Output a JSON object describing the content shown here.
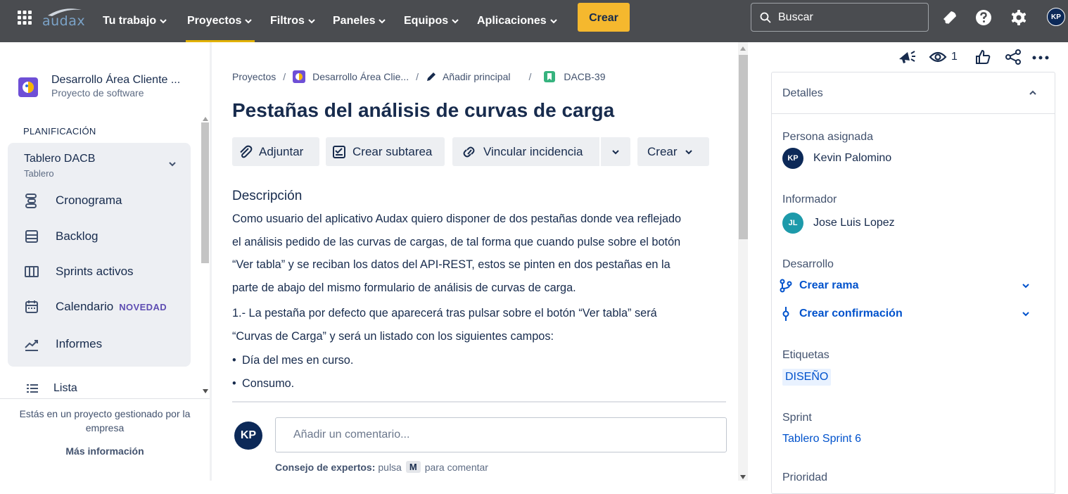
{
  "nav": {
    "logo_text": "audax",
    "items": [
      {
        "label": "Tu trabajo"
      },
      {
        "label": "Proyectos"
      },
      {
        "label": "Filtros"
      },
      {
        "label": "Paneles"
      },
      {
        "label": "Equipos"
      },
      {
        "label": "Aplicaciones"
      }
    ],
    "active_item": "Proyectos",
    "create_label": "Crear",
    "search_placeholder": "Buscar",
    "avatar_initials": "KP",
    "accent_color": "#f5b82e",
    "bar_color": "#4a4c50"
  },
  "sidebar": {
    "project_name": "Desarrollo Área Cliente ...",
    "project_type": "Proyecto de software",
    "section_heading": "PLANIFICACIÓN",
    "board": {
      "title": "Tablero DACB",
      "subtitle": "Tablero"
    },
    "items": [
      {
        "label": "Cronograma",
        "icon": "timeline-icon"
      },
      {
        "label": "Backlog",
        "icon": "backlog-icon"
      },
      {
        "label": "Sprints activos",
        "icon": "sprints-icon"
      },
      {
        "label": "Calendario",
        "icon": "calendar-icon",
        "badge": "NOVEDAD"
      },
      {
        "label": "Informes",
        "icon": "reports-icon"
      }
    ],
    "list_item": "Lista",
    "managed_text": "Estás en un proyecto gestionado por la empresa",
    "more_info": "Más información"
  },
  "breadcrumb": {
    "projects": "Proyectos",
    "project": "Desarrollo Área Clie...",
    "add_parent": "Añadir principal",
    "issue_key": "DACB-39"
  },
  "issue": {
    "title": "Pestañas del análisis de curvas de carga",
    "toolbar": {
      "attach": "Adjuntar",
      "subtask": "Crear subtarea",
      "link": "Vincular incidencia",
      "create": "Crear"
    },
    "description_heading": "Descripción",
    "description_lines": [
      "Como usuario del aplicativo Audax quiero disponer de dos pestañas donde vea reflejado",
      "el análisis pedido de las curvas de cargas, de tal forma que cuando pulse sobre el botón",
      "“Ver tabla” y se reciban los datos del API-REST, estos se pinten en dos pestañas en la",
      "parte de abajo del mismo formulario de análisis de curvas de carga."
    ],
    "description_lines_2": [
      "1.- La pestaña por defecto que aparecerá tras pulsar sobre el botón “Ver tabla” será",
      "“Curvas de Carga” y será un listado con los siguientes campos:"
    ],
    "bullets": [
      "Día del mes en curso.",
      "Consumo."
    ],
    "comment_placeholder": "Añadir un comentario...",
    "comment_avatar": "KP",
    "tip_bold": "Consejo de expertos:",
    "tip_pre": "pulsa",
    "tip_key": "M",
    "tip_post": "para comentar"
  },
  "details": {
    "watchers_count": "1",
    "title": "Detalles",
    "assignee_label": "Persona asignada",
    "assignee": {
      "initials": "KP",
      "name": "Kevin Palomino",
      "color": "#0c2958"
    },
    "reporter_label": "Informador",
    "reporter": {
      "initials": "JL",
      "name": "Jose Luis Lopez",
      "color": "#1d9aaa"
    },
    "development_label": "Desarrollo",
    "create_branch": "Crear rama",
    "create_commit": "Crear confirmación",
    "labels_label": "Etiquetas",
    "label_value": "DISEÑO",
    "sprint_label": "Sprint",
    "sprint_value": "Tablero Sprint 6",
    "priority_label": "Prioridad"
  }
}
